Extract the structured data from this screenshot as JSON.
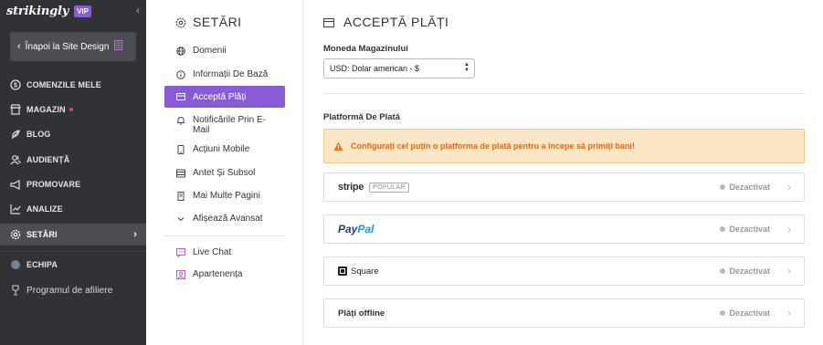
{
  "sidebar": {
    "brand": "strikingly",
    "badge": "VIP",
    "collapse_icon": "chevron-left-icon",
    "back_button": "Înapoi la Site Design",
    "items": [
      {
        "label": "COMENZILE MELE",
        "icon": "dollar-circle-icon"
      },
      {
        "label": "MAGAZIN",
        "icon": "store-icon",
        "notification": true
      },
      {
        "label": "BLOG",
        "icon": "quill-icon"
      },
      {
        "label": "AUDIENȚĂ",
        "icon": "users-icon"
      },
      {
        "label": "PROMOVARE",
        "icon": "megaphone-icon"
      },
      {
        "label": "ANALIZE",
        "icon": "chart-icon"
      },
      {
        "label": "SETĂRI",
        "icon": "gear-icon",
        "active": true
      },
      {
        "label": "ECHIPA",
        "icon": "globe-icon"
      },
      {
        "label": "Programul de afiliere",
        "icon": "trophy-icon"
      }
    ]
  },
  "settings_nav": {
    "title": "SETĂRI",
    "items": [
      {
        "label": "Domenii",
        "icon": "globe-icon"
      },
      {
        "label": "Informații De Bază",
        "icon": "info-icon"
      },
      {
        "label": "Acceptă Plăți",
        "icon": "credit-card-icon",
        "active": true
      },
      {
        "label": "Notificările Prin E-Mail",
        "icon": "bell-icon"
      },
      {
        "label": "Acțiuni Mobile",
        "icon": "mobile-icon"
      },
      {
        "label": "Antet Și Subsol",
        "icon": "layout-icon"
      },
      {
        "label": "Mai Multe Pagini",
        "icon": "pages-icon"
      },
      {
        "label": "Afișează Avansat",
        "icon": "chevron-down-icon"
      },
      {
        "label": "Live Chat",
        "icon": "chat-icon"
      },
      {
        "label": "Apartenența",
        "icon": "member-icon"
      }
    ]
  },
  "main": {
    "title": "ACCEPTĂ PLĂȚI",
    "currency_label": "Moneda Magazinului",
    "currency_value": "USD: Dolar american - $",
    "platform_label": "Platformă De Plată",
    "warning": "Configurați cel puțin o platforma de plată pentru a începe să primiți bani!",
    "providers": [
      {
        "name": "stripe",
        "badge": "POPULAR",
        "status": "Dezactivat"
      },
      {
        "name_a": "Pay",
        "name_b": "Pal",
        "status": "Dezactivat"
      },
      {
        "name": "Square",
        "status": "Dezactivat"
      },
      {
        "name": "Plăți offline",
        "status": "Dezactivat"
      }
    ]
  },
  "colors": {
    "sidebar_bg": "#313235",
    "accent": "#8a5bd6",
    "warning_bg": "#fbe6c6",
    "warning_text": "#d9691a"
  }
}
